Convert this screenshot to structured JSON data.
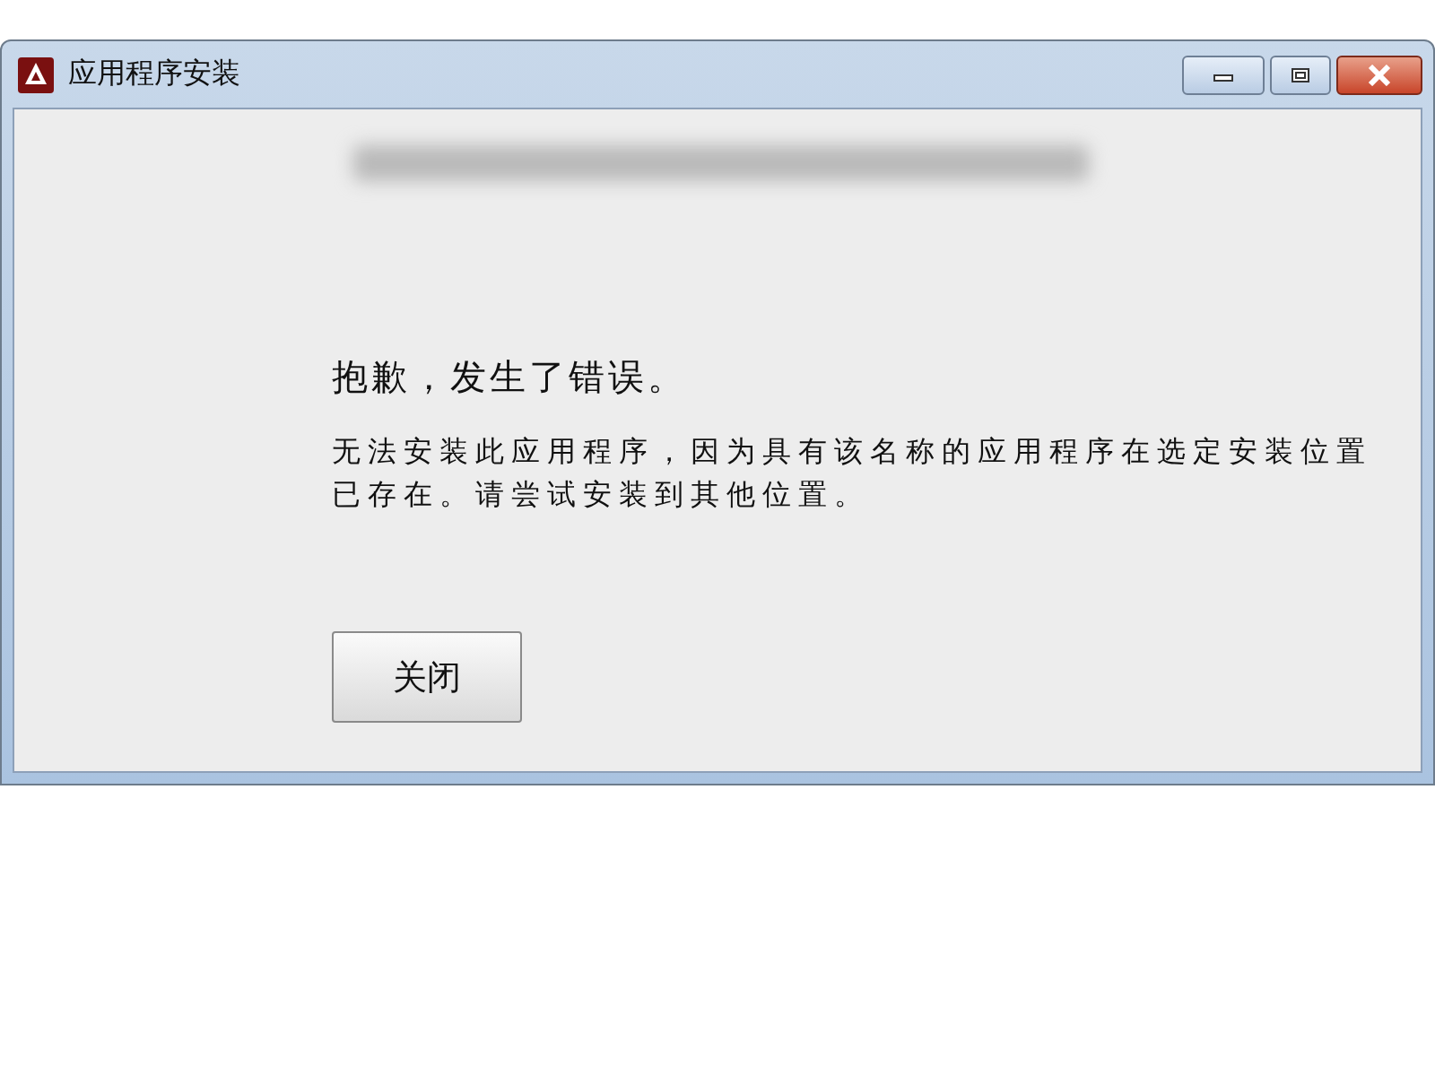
{
  "window": {
    "title": "应用程序安装"
  },
  "heading": "抱歉，发生了错误。",
  "message": "无法安装此应用程序，因为具有该名称的应用程序在选定安装位置已存在。请尝试安装到其他位置。",
  "buttons": [
    "关闭"
  ]
}
